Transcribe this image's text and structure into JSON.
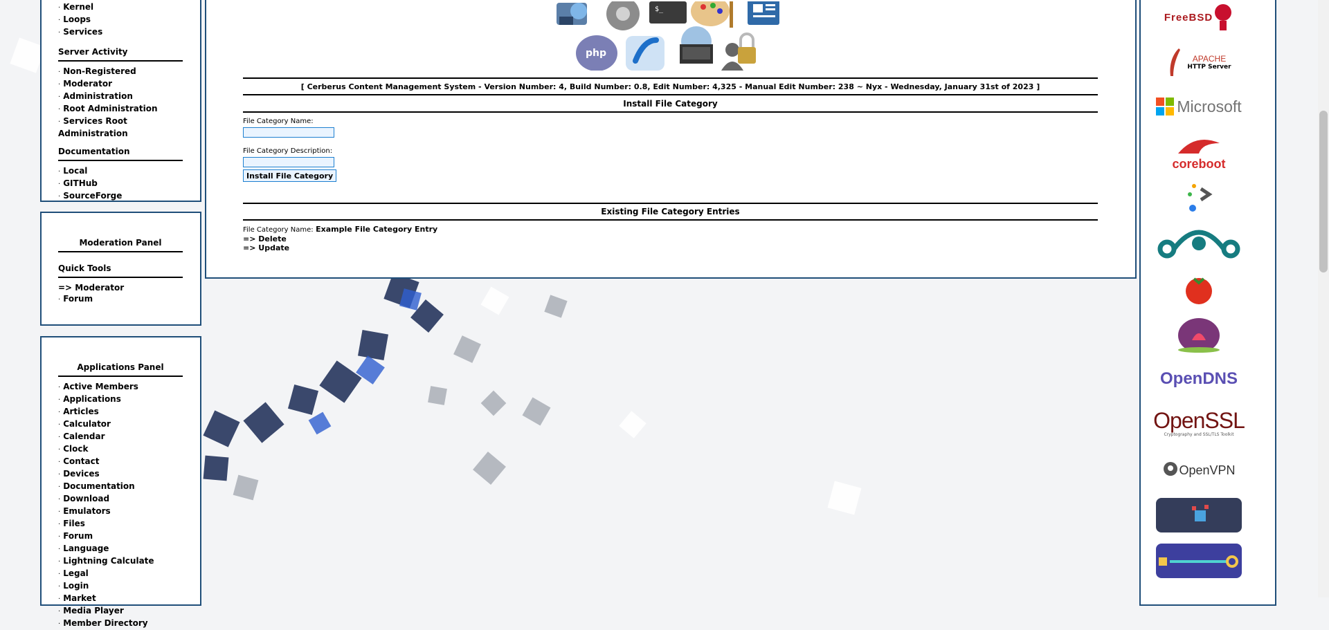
{
  "left_panel_top": {
    "top_items": [
      "Kernel",
      "Loops",
      "Services"
    ],
    "server_activity": {
      "title": "Server Activity",
      "items": [
        "Non-Registered",
        "Moderator",
        "Administration",
        "Root Administration",
        "Services Root Administration"
      ]
    },
    "documentation": {
      "title": "Documentation",
      "items": [
        "Local",
        "GITHub",
        "SourceForge"
      ]
    }
  },
  "moderation_panel": {
    "title": "Moderation Panel",
    "quick_tools": "Quick Tools",
    "items": [
      "=> Moderator",
      "Forum"
    ]
  },
  "applications_panel": {
    "title": "Applications Panel",
    "items": [
      "Active Members",
      "Applications",
      "Articles",
      "Calculator",
      "Calendar",
      "Clock",
      "Contact",
      "Devices",
      "Documentation",
      "Download",
      "Emulators",
      "Files",
      "Forum",
      "Language",
      "Lightning Calculate",
      "Legal",
      "Login",
      "Market",
      "Media Player",
      "Member Directory"
    ]
  },
  "main": {
    "version_line": "[ Cerberus Content Management System - Version Number: 4, Build Number: 0.8, Edit Number: 4,325 - Manual Edit Number: 238 ~ Nyx - Wednesday, January 31st of 2023 ]",
    "install_title": "Install File Category",
    "name_label": "File Category Name:",
    "desc_label": "File Category Description:",
    "install_button": "Install File Category",
    "existing_title": "Existing File Category Entries",
    "entry_label": "File Category Name:",
    "entry_value": "Example File Category Entry",
    "delete_link": "=> Delete",
    "update_link": "=> Update"
  },
  "right_logos": {
    "freebsd": "FreeBSD",
    "apache_1": "APACHE",
    "apache_2": "HTTP Server",
    "microsoft": "Microsoft",
    "coreboot": "coreboot",
    "opendns": "OpenDNS",
    "openssl": "OpenSSL",
    "openssl_sub": "Cryptography and SSL/TLS Toolkit",
    "openvpn": "OpenVPN"
  },
  "colors": {
    "panel_border": "#1f4e79",
    "input_border": "#1d7fd0",
    "microsoft_red": "#f25022",
    "microsoft_green": "#7fba00",
    "microsoft_blue": "#00a4ef",
    "microsoft_yellow": "#ffb900"
  },
  "icons": [
    "network-icon",
    "gear-icon",
    "terminal-icon",
    "palette-icon",
    "newspaper-icon",
    "php-icon",
    "phone-icon",
    "computers-icon",
    "user-lock-icon"
  ]
}
